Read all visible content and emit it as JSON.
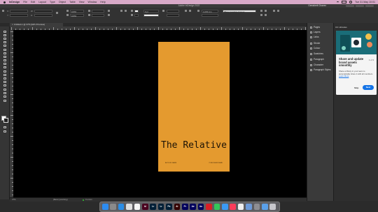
{
  "menubar": {
    "app_name": "InDesign",
    "items": [
      "File",
      "Edit",
      "Layout",
      "Type",
      "Object",
      "Table",
      "View",
      "Window",
      "Help"
    ],
    "clock": "Tue 31 May 10:01"
  },
  "window": {
    "title": "Adobe InDesign 2022",
    "account": "Gewisheit Chavez"
  },
  "controlbar": {
    "x_label": "X:",
    "y_label": "Y:",
    "w_label": "W:",
    "h_label": "H:",
    "stroke_weight": "0 pt",
    "percent_a": "100%",
    "percent_b": "100%",
    "zoom_value": "4.233 mm",
    "style_dropdown": "[Basic Graphics Frame]"
  },
  "document_tab": {
    "label": "Untitled-1 @ 37% [GPU Preview]"
  },
  "statusbar": {
    "zoom": "37%",
    "preset": "[Basic] (working)",
    "errors": "0 errors"
  },
  "book_cover": {
    "title": "The Relative",
    "footer_left": "AUTHOR NAME",
    "footer_right": "PUBLISHER NAME"
  },
  "panels": [
    {
      "label": "Pages",
      "icon": "pages-icon"
    },
    {
      "label": "Layers",
      "icon": "layers-icon"
    },
    {
      "label": "Links",
      "icon": "links-icon"
    },
    {
      "label": "Stroke",
      "icon": "stroke-icon"
    },
    {
      "label": "Colour",
      "icon": "colour-icon"
    },
    {
      "label": "Swatches",
      "icon": "swatches-icon"
    },
    {
      "label": "Paragraph",
      "icon": "paragraph-icon"
    },
    {
      "label": "Character",
      "icon": "character-icon"
    },
    {
      "label": "Paragraph Styles",
      "icon": "paragraph-styles-icon"
    }
  ],
  "cc_libraries": {
    "header": "CC Libraries",
    "heading": "Share and update brand assets smoothly",
    "count": "1 of 3",
    "body": "Share a library in your team to automatically share it with all members.",
    "link": "Learn More",
    "skip_label": "Skip",
    "next_label": "Next"
  },
  "dock": {
    "apps": [
      {
        "name": "Finder",
        "color": "#2d8cf0",
        "glyph": ""
      },
      {
        "name": "Launchpad",
        "color": "#8a8a8a",
        "glyph": ""
      },
      {
        "name": "Safari",
        "color": "#2a8de6",
        "glyph": ""
      },
      {
        "name": "Chrome",
        "color": "#dfdfdf",
        "glyph": ""
      },
      {
        "name": "Calendar",
        "color": "#f5f5f5",
        "glyph": ""
      },
      {
        "name": "InDesign",
        "color": "#49021f",
        "glyph": "Id"
      },
      {
        "name": "Lightroom Classic",
        "color": "#001e36",
        "glyph": "Lr"
      },
      {
        "name": "Lightroom",
        "color": "#001e36",
        "glyph": "Lr"
      },
      {
        "name": "Photoshop",
        "color": "#001e36",
        "glyph": "Ps"
      },
      {
        "name": "Illustrator",
        "color": "#330000",
        "glyph": "Ai"
      },
      {
        "name": "Premiere Pro",
        "color": "#00005b",
        "glyph": "Pr"
      },
      {
        "name": "After Effects",
        "color": "#00005b",
        "glyph": "Ae"
      },
      {
        "name": "Audition",
        "color": "#00005b",
        "glyph": "Au"
      },
      {
        "name": "Creative Cloud",
        "color": "#da1f26",
        "glyph": ""
      },
      {
        "name": "Messages",
        "color": "#34c759",
        "glyph": ""
      },
      {
        "name": "Mail",
        "color": "#3b9af5",
        "glyph": ""
      },
      {
        "name": "Music",
        "color": "#fa3d5a",
        "glyph": ""
      },
      {
        "name": "Photos",
        "color": "#eeeeee",
        "glyph": ""
      },
      {
        "name": "Preview",
        "color": "#6c9ad9",
        "glyph": ""
      },
      {
        "name": "System Preferences",
        "color": "#8e8e93",
        "glyph": ""
      },
      {
        "name": "Folder",
        "color": "#5aa0e8",
        "glyph": ""
      },
      {
        "name": "Trash",
        "color": "#c7c7cc",
        "glyph": ""
      }
    ]
  },
  "colors": {
    "menubar_bg": "#d8a9c8",
    "page_orange": "#e49a2f",
    "accent_blue": "#1473e6"
  }
}
